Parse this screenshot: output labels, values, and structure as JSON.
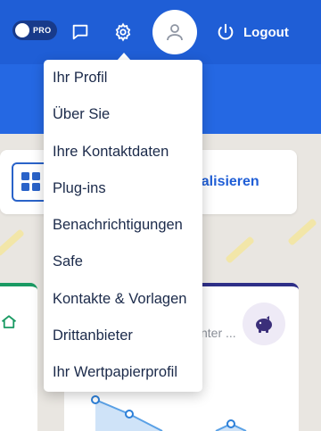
{
  "header": {
    "pro_label": "PRO",
    "logout_label": "Logout",
    "icons": [
      "toggle",
      "chat-icon",
      "gear-icon",
      "user-icon",
      "power-icon"
    ]
  },
  "card": {
    "personalize_label": "nalisieren"
  },
  "widget": {
    "truncated_text": "nter ..."
  },
  "menu": {
    "items": [
      {
        "label": "Ihr Profil"
      },
      {
        "label": "Über Sie"
      },
      {
        "label": "Ihre Kontaktdaten"
      },
      {
        "label": "Plug-ins"
      },
      {
        "label": "Benachrichtigungen"
      },
      {
        "label": "Safe"
      },
      {
        "label": "Kontakte & Vorlagen"
      },
      {
        "label": "Drittanbieter"
      },
      {
        "label": "Ihr Wertpapierprofil"
      }
    ]
  },
  "colors": {
    "header_bg": "#1f5ed6",
    "banner_bg": "#2568e3",
    "accent_blue": "#1f5ed6",
    "green_accent": "#1a9a63",
    "navy_accent": "#2e2f88"
  }
}
